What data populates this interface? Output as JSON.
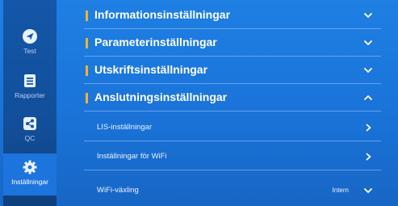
{
  "sidebar": {
    "items": [
      {
        "label": "Test",
        "icon": "navigation-arrow-icon",
        "active": false
      },
      {
        "label": "Rapporter",
        "icon": "report-list-icon",
        "active": false
      },
      {
        "label": "QC",
        "icon": "share-icon",
        "active": false
      },
      {
        "label": "Inställningar",
        "icon": "gear-icon",
        "active": true
      }
    ]
  },
  "sections": [
    {
      "title": "Informationsinställningar",
      "state": "collapsed"
    },
    {
      "title": "Parameterinställningar",
      "state": "collapsed"
    },
    {
      "title": "Utskriftsinställningar",
      "state": "collapsed"
    },
    {
      "title": "Anslutningsinställningar",
      "state": "expanded"
    }
  ],
  "connection_items": [
    {
      "label": "LIS-inställningar"
    },
    {
      "label": "Inställningar för WiFi"
    },
    {
      "label": "WiFi-växling",
      "value": "Intern"
    }
  ],
  "colors": {
    "accent_bar": "#f2b233",
    "active_tab": "#1d74dd"
  }
}
